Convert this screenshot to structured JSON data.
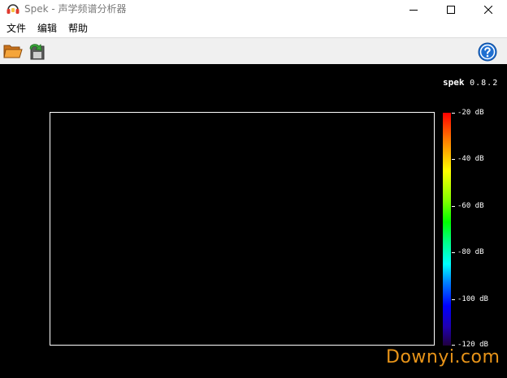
{
  "window": {
    "title": "Spek - 声学频谱分析器",
    "icon": "headphones-icon"
  },
  "menu": {
    "file": "文件",
    "edit": "编辑",
    "help": "帮助"
  },
  "toolbar": {
    "open_icon": "folder-open-icon",
    "save_icon": "save-export-icon",
    "help_icon": "help-icon"
  },
  "spectrogram": {
    "brand_name": "spek",
    "brand_version": "0.8.2",
    "db_labels": [
      "-20 dB",
      "-40 dB",
      "-60 dB",
      "-80 dB",
      "-100 dB",
      "-120 dB"
    ],
    "colors": {
      "background": "#000000",
      "frame": "#ffffff"
    }
  },
  "watermark": "Downyi.com"
}
